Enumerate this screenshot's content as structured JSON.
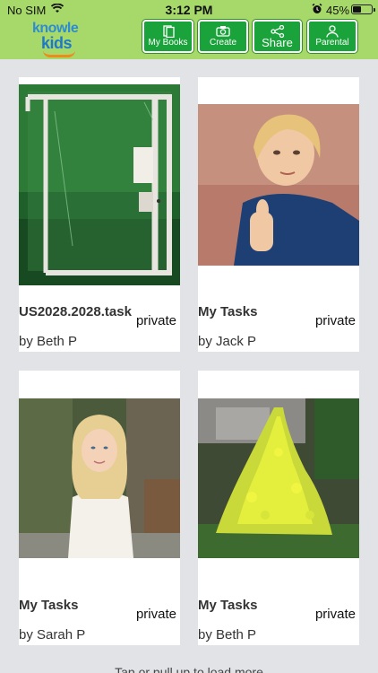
{
  "status": {
    "carrier": "No SIM",
    "time": "3:12 PM",
    "battery": "45%",
    "battery_level": 0.45
  },
  "logo": {
    "line1": "knowle",
    "line2": "kids"
  },
  "nav": [
    {
      "label": "My Books",
      "icon": "books-icon"
    },
    {
      "label": "Create",
      "icon": "camera-icon"
    },
    {
      "label": "Share",
      "icon": "share-icon"
    },
    {
      "label": "Parental",
      "icon": "person-icon"
    }
  ],
  "cards": [
    {
      "title": "US2028.2028.task",
      "privacy": "private",
      "author": "by Beth P",
      "image": "acrylic-display-case-photo"
    },
    {
      "title": "My Tasks",
      "privacy": "private",
      "author": "by Jack P",
      "image": "boy-thumbs-up-photo"
    },
    {
      "title": "My Tasks",
      "privacy": "private",
      "author": "by Sarah P",
      "image": "girl-portrait-photo"
    },
    {
      "title": "My Tasks",
      "privacy": "private",
      "author": "by Beth P",
      "image": "yellow-flower-photo"
    }
  ],
  "footer": {
    "text": "Tap or pull up to load more"
  },
  "colors": {
    "header": "#a6d86a",
    "button": "#1aa33a",
    "background": "#e1e3e7"
  }
}
